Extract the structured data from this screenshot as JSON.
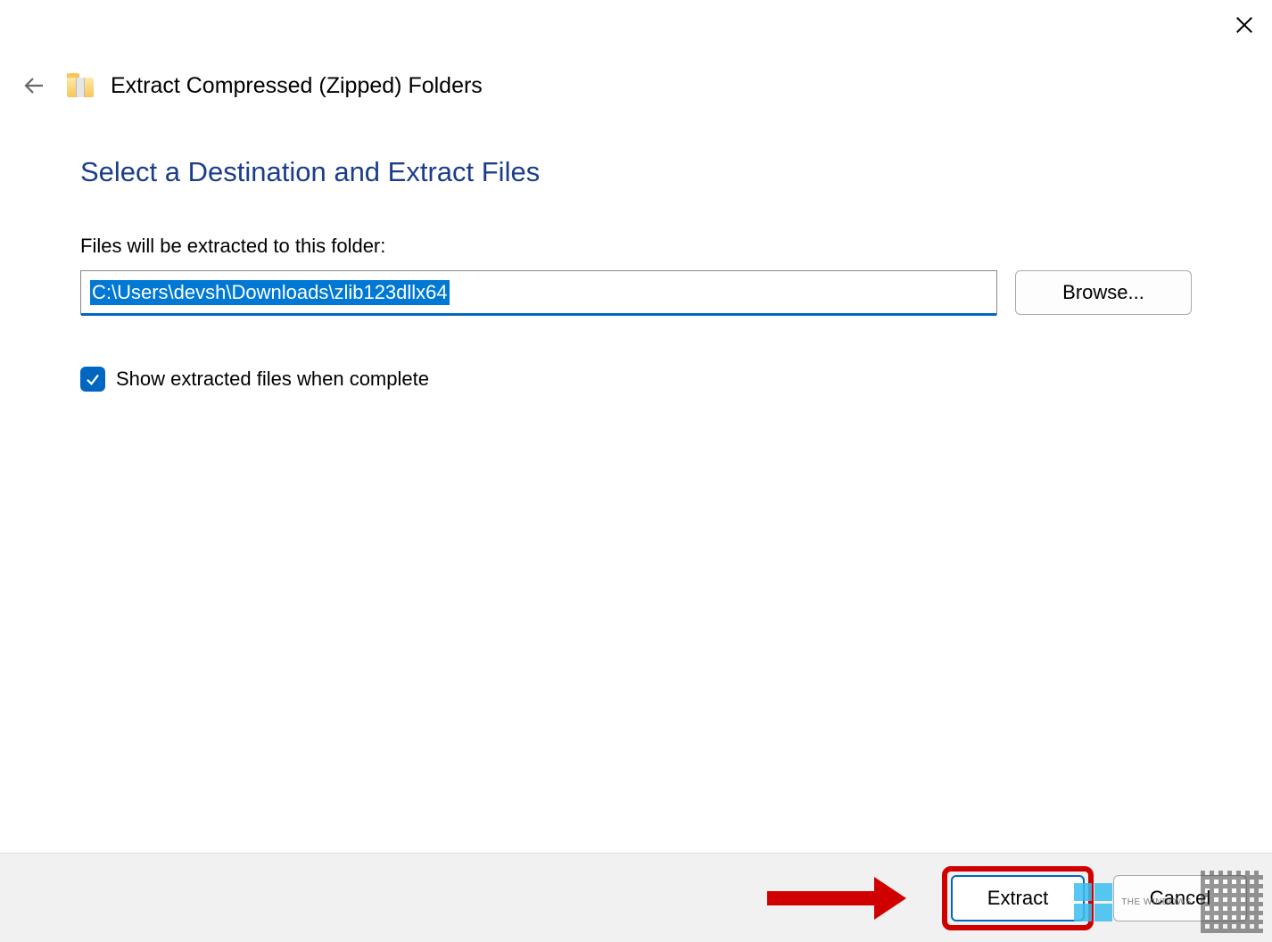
{
  "titlebar": {
    "close_label": "Close"
  },
  "header": {
    "back_label": "Back",
    "title": "Extract Compressed (Zipped) Folders"
  },
  "main": {
    "heading": "Select a Destination and Extract Files",
    "path_label": "Files will be extracted to this folder:",
    "path_value": "C:\\Users\\devsh\\Downloads\\zlib123dllx64",
    "browse_label": "Browse...",
    "checkbox_label": "Show extracted files when complete",
    "checkbox_checked": true
  },
  "footer": {
    "extract_label": "Extract",
    "cancel_label": "Cancel"
  },
  "watermark": {
    "text": "THE WINDOWS"
  }
}
